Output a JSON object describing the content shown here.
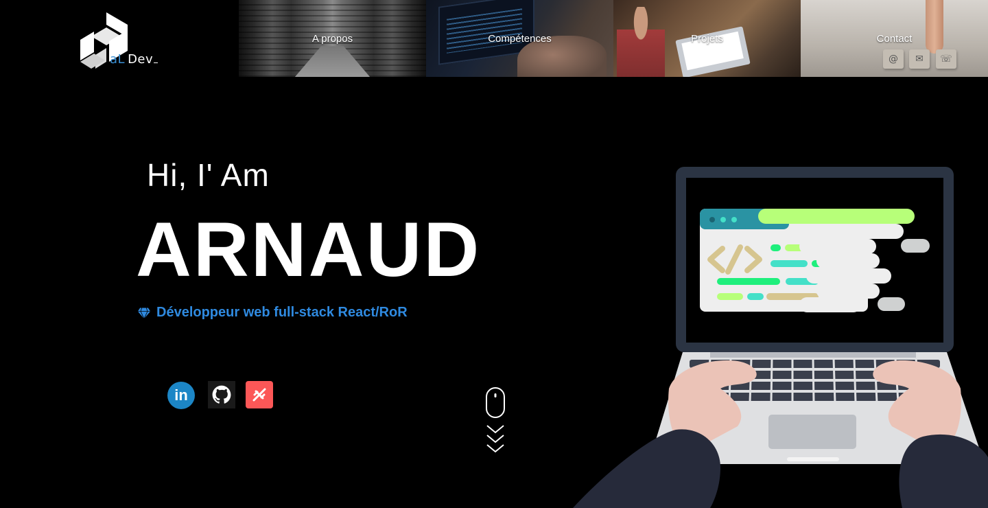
{
  "logo": {
    "prefix": "aL",
    "suffix": "Dev"
  },
  "nav": {
    "items": [
      {
        "label": "A propos"
      },
      {
        "label": "Compétences"
      },
      {
        "label": "Projets"
      },
      {
        "label": "Contact"
      }
    ]
  },
  "hero": {
    "greeting": "Hi, I' Am",
    "name": "ARNAUD",
    "role": "Développeur web full-stack React/RoR"
  },
  "socials": {
    "linkedin_text": "in"
  },
  "colors": {
    "accent": "#2f8ae0",
    "linkedin": "#1c86c6",
    "malt": "#fc5757",
    "background": "#000000"
  },
  "icons": [
    "logo-mark-icon",
    "diamond-icon",
    "linkedin-icon",
    "github-icon",
    "malt-icon",
    "mouse-icon",
    "chevrons-down-icon"
  ]
}
